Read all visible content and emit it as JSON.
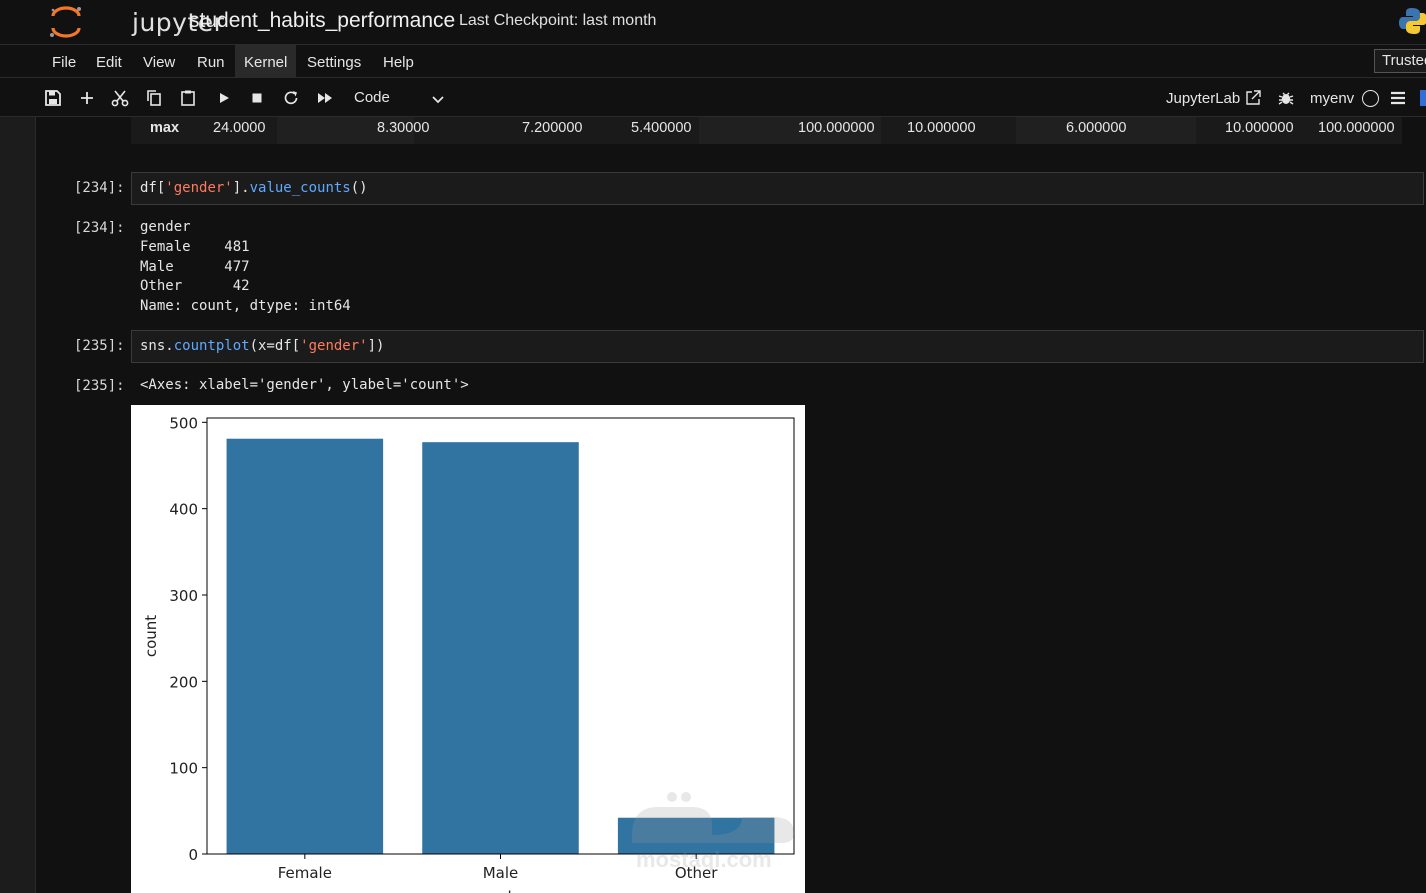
{
  "app": {
    "logo_text": "jupyter",
    "notebook_title": "student_habits_performance",
    "checkpoint": "Last Checkpoint: last month"
  },
  "menu": {
    "items": [
      "File",
      "Edit",
      "View",
      "Run",
      "Kernel",
      "Settings",
      "Help"
    ],
    "active": "Kernel",
    "trusted_label": "Trusted"
  },
  "toolbar": {
    "icons": [
      "save-icon",
      "add-cell-icon",
      "cut-icon",
      "copy-icon",
      "paste-icon",
      "run-icon",
      "stop-icon",
      "restart-icon",
      "fast-forward-icon"
    ],
    "cell_type": "Code",
    "jupyterlab_label": "JupyterLab",
    "kernel_name": "myenv"
  },
  "summary_table": {
    "row_label": "max",
    "values": [
      "24.0000",
      "8.30000",
      "7.200000",
      "5.400000",
      "100.000000",
      "10.000000",
      "6.000000",
      "10.000000",
      "100.000000"
    ]
  },
  "cells": [
    {
      "prompt_in": "[234]:",
      "code_parts": [
        "df[",
        "'gender'",
        "].",
        "value_counts",
        "()"
      ],
      "prompt_out": "[234]:",
      "output_lines": [
        "gender",
        "Female    481",
        "Male      477",
        "Other      42",
        "Name: count, dtype: int64"
      ]
    },
    {
      "prompt_in": "[235]:",
      "code_parts": [
        "sns.",
        "countplot",
        "(x=df[",
        "'gender'",
        "])"
      ],
      "prompt_out": "[235]:",
      "output_lines": [
        "<Axes: xlabel='gender', ylabel='count'>"
      ]
    }
  ],
  "chart_data": {
    "type": "bar",
    "categories": [
      "Female",
      "Male",
      "Other"
    ],
    "values": [
      481,
      477,
      42
    ],
    "ylabel": "count",
    "xlabel": "gender",
    "ylim": [
      0,
      505
    ],
    "yticks": [
      0,
      100,
      200,
      300,
      400,
      500
    ],
    "bar_color": "#3274a1",
    "grid": false
  },
  "watermark": {
    "text": "mostaql.com"
  },
  "colors": {
    "background": "#111111",
    "string": "#ff7a5e",
    "function": "#5fa8ff"
  }
}
